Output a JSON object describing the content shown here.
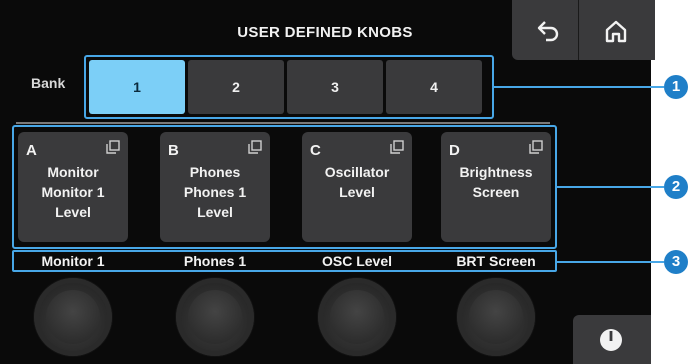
{
  "header": {
    "title": "USER DEFINED KNOBS"
  },
  "icons": {
    "back": "back-arrow-icon",
    "home": "home-icon",
    "copy": "copy-icon",
    "power": "power-icon"
  },
  "bank": {
    "label": "Bank",
    "buttons": [
      "1",
      "2",
      "3",
      "4"
    ],
    "selected": "1"
  },
  "knob_buttons": [
    {
      "letter": "A",
      "lines": [
        "Monitor",
        "Monitor 1",
        "Level"
      ]
    },
    {
      "letter": "B",
      "lines": [
        "Phones",
        "Phones 1",
        "Level"
      ]
    },
    {
      "letter": "C",
      "lines": [
        "Oscillator",
        "Level"
      ]
    },
    {
      "letter": "D",
      "lines": [
        "Brightness",
        "Screen"
      ]
    }
  ],
  "knob_names": [
    "Monitor 1",
    "Phones 1",
    "OSC Level",
    "BRT Screen"
  ],
  "callouts": [
    "1",
    "2",
    "3"
  ],
  "colors": {
    "accent": "#48a7e7",
    "selected": "#7ccff7",
    "callout": "#1f7fc8",
    "button": "#3a3a3c"
  }
}
